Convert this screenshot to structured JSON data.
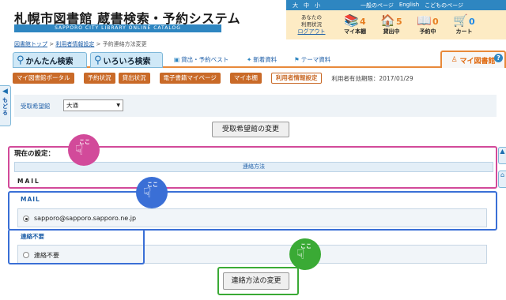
{
  "topbar": {
    "font_sizes": [
      "大",
      "中",
      "小"
    ],
    "links": [
      "一般のページ",
      "English",
      "こどものページ"
    ]
  },
  "header": {
    "title": "札幌市図書館 蔵書検索・予約システム",
    "subtitle": "SAPPORO CITY LIBRARY ONLINE CATALOG"
  },
  "user_panel": {
    "status_line1": "あなたの",
    "status_line2": "利用状況",
    "logout": "ログアウト",
    "items": [
      {
        "label": "マイ本棚",
        "count": "4",
        "icon": "bookshelf-icon",
        "glyph": "📚",
        "color": "orange"
      },
      {
        "label": "貸出中",
        "count": "5",
        "icon": "house-icon",
        "glyph": "🏠",
        "color": "orange"
      },
      {
        "label": "予約中",
        "count": "0",
        "icon": "reserve-icon",
        "glyph": "📖",
        "color": "orange"
      },
      {
        "label": "カート",
        "count": "0",
        "icon": "cart-icon",
        "glyph": "🛒",
        "color": "blue"
      }
    ]
  },
  "breadcrumb": {
    "home": "図書館トップ",
    "sep": " > ",
    "parent": "利用者情報設定",
    "current": "予約連絡方法変更"
  },
  "tabs": {
    "easy_search": "かんたん検索",
    "advanced_search": "いろいろ検索",
    "best_loans": "貸出・予約ベスト",
    "new_items": "新着資料",
    "theme": "テーマ資料",
    "my_library": "マイ図書館",
    "help": "?"
  },
  "subnav": {
    "portal": "マイ図書館ポータル",
    "reservations": "予約状況",
    "loans": "貸出状況",
    "ebook": "電子書籍マイページ",
    "bookshelf": "マイ本棚",
    "user_settings": "利用者情報設定",
    "expiry": "利用者有効期限：2017/01/29"
  },
  "back_tab": "もどる",
  "pickup": {
    "label": "受取希望館",
    "selected": "大通",
    "change_button": "受取希望館の変更"
  },
  "current_setting": {
    "label": "現在の設定：",
    "column_header": "連絡方法",
    "value": "MAIL"
  },
  "options": {
    "mail_heading": "MAIL",
    "mail_value": "sapporo@sapporo.sapporo.ne.jp",
    "none_heading": "連絡不要",
    "none_value": "連絡不要"
  },
  "change_method_button": "連絡方法の変更",
  "annotations": {
    "koko": "ここ"
  },
  "colors": {
    "accent_blue": "#2e86c1",
    "accent_orange": "#e8893a",
    "highlight_pink": "#d24a9a",
    "highlight_blue": "#3a6fd6",
    "highlight_green": "#3aaa35"
  }
}
